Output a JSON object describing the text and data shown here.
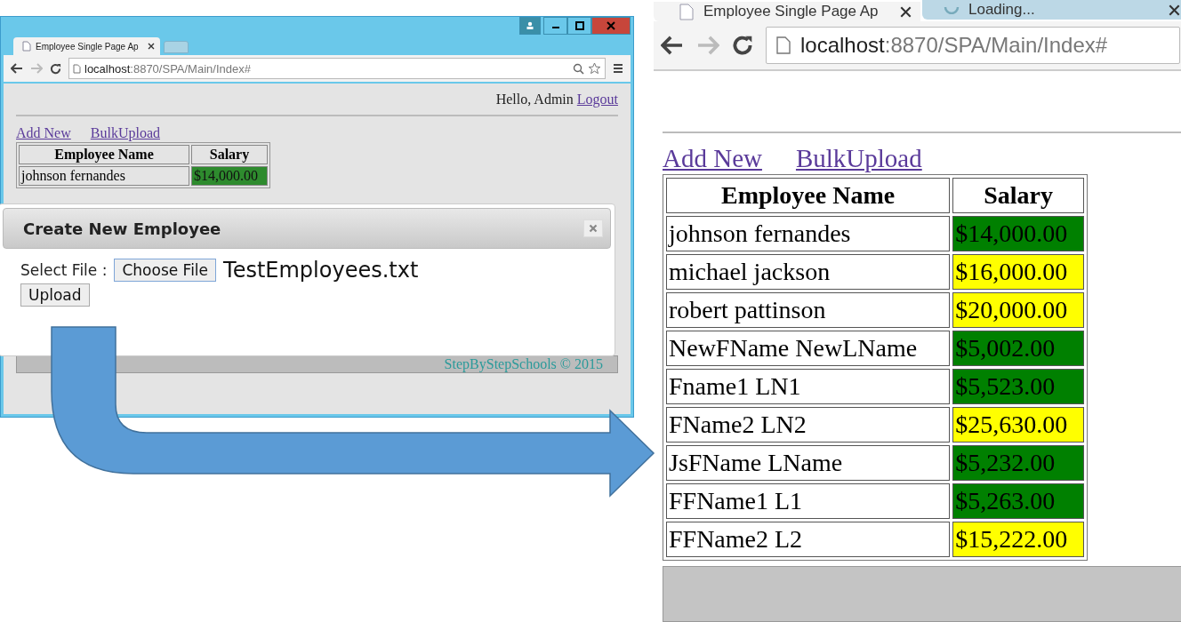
{
  "left_window": {
    "tabs": [
      {
        "label": "Employee Single Page Ap",
        "selected": true
      }
    ],
    "url": {
      "host": "localhost",
      "path": ":8870/SPA/Main/Index#"
    },
    "greeting": "Hello, Admin",
    "logout": "Logout",
    "links": [
      "Add New",
      "BulkUpload"
    ],
    "table": {
      "columns": [
        "Employee Name",
        "Salary"
      ],
      "rows": [
        {
          "name": "johnson fernandes",
          "salary": "$14,000.00",
          "color": "#2e8b2e"
        }
      ]
    },
    "footer": "StepByStepSchools © 2015",
    "dialog": {
      "title": "Create New Employee",
      "file_label": "Select File :",
      "choose_button": "Choose File",
      "file_name": "TestEmployees.txt",
      "upload_button": "Upload"
    }
  },
  "right_window": {
    "tabs": [
      {
        "label": "Employee Single Page Ap",
        "selected": true
      },
      {
        "label": "Loading...",
        "selected": false
      }
    ],
    "url": {
      "host": "localhost",
      "path": ":8870/SPA/Main/Index#"
    },
    "links": [
      "Add New",
      "BulkUpload"
    ],
    "table": {
      "columns": [
        "Employee Name",
        "Salary"
      ],
      "rows": [
        {
          "name": "johnson fernandes",
          "salary": "$14,000.00",
          "color": "#008000"
        },
        {
          "name": "michael jackson",
          "salary": "$16,000.00",
          "color": "#ffff00"
        },
        {
          "name": "robert pattinson",
          "salary": "$20,000.00",
          "color": "#ffff00"
        },
        {
          "name": "NewFName NewLName",
          "salary": "$5,002.00",
          "color": "#008000"
        },
        {
          "name": "Fname1 LN1",
          "salary": "$5,523.00",
          "color": "#008000"
        },
        {
          "name": "FName2 LN2",
          "salary": "$25,630.00",
          "color": "#ffff00"
        },
        {
          "name": "JsFName LName",
          "salary": "$5,232.00",
          "color": "#008000"
        },
        {
          "name": "FFName1 L1",
          "salary": "$5,263.00",
          "color": "#008000"
        },
        {
          "name": "FFName2 L2",
          "salary": "$15,222.00",
          "color": "#ffff00"
        }
      ]
    }
  }
}
